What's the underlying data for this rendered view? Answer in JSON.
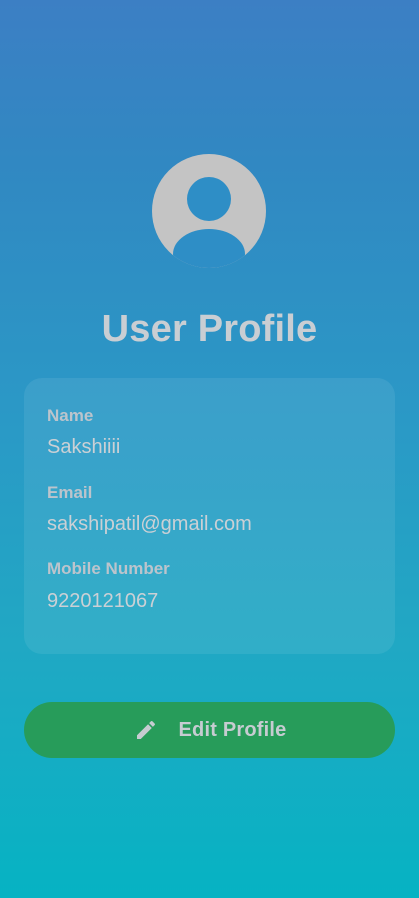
{
  "profile": {
    "title": "User Profile",
    "avatar_icon": "person-icon",
    "fields": [
      {
        "label": "Name",
        "value": "Sakshiiii"
      },
      {
        "label": "Email",
        "value": "sakshipatil@gmail.com"
      },
      {
        "label": "Mobile Number",
        "value": "9220121067"
      }
    ]
  },
  "actions": {
    "edit_label": "Edit Profile",
    "edit_icon": "pencil-icon"
  },
  "colors": {
    "gradient_top": "#3c7fc4",
    "gradient_bottom": "#06b3c3",
    "button": "#279c5a",
    "avatar": "#c4c4c4"
  }
}
